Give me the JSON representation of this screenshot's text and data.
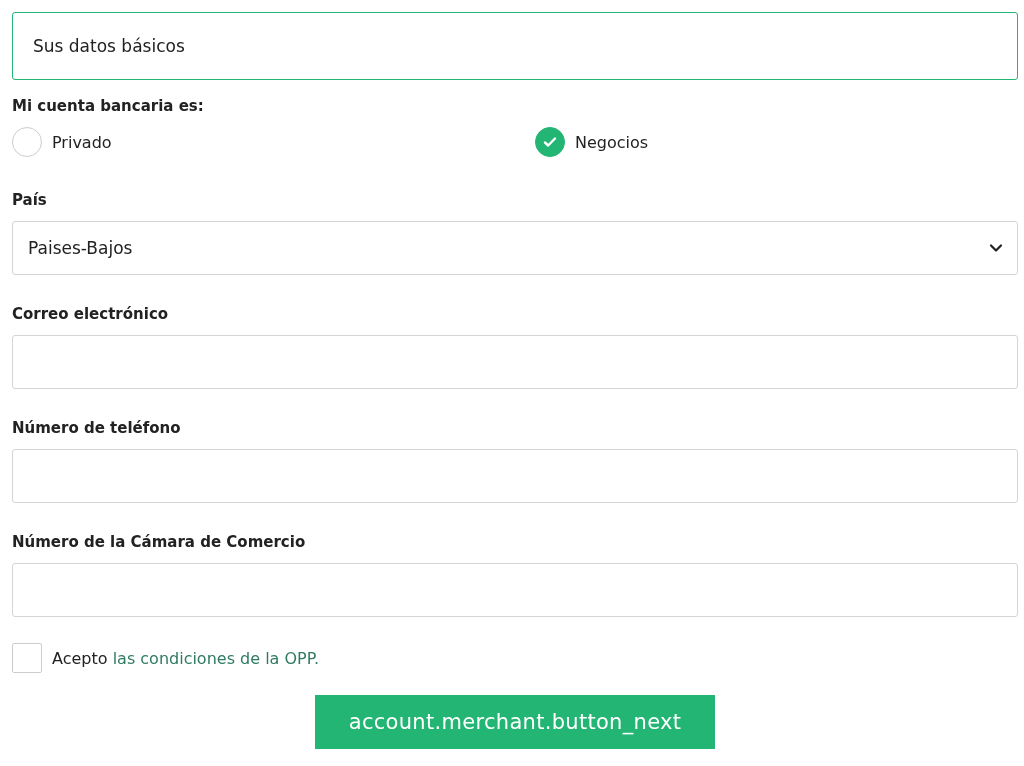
{
  "header": {
    "title": "Sus datos básicos"
  },
  "account_type": {
    "label": "Mi cuenta bancaria es:",
    "options": [
      {
        "label": "Privado",
        "selected": false
      },
      {
        "label": "Negocios",
        "selected": true
      }
    ]
  },
  "fields": [
    {
      "kind": "select",
      "label": "País",
      "value": "Paises-Bajos"
    },
    {
      "kind": "text",
      "label": "Correo electrónico"
    },
    {
      "kind": "text",
      "label": "Número de teléfono"
    },
    {
      "kind": "text",
      "label": "Número de la Cámara de Comercio"
    }
  ],
  "terms": {
    "checked": false,
    "text": "Acepto",
    "link": "las condiciones de la OPP."
  },
  "button": {
    "label": "account.merchant.button_next"
  }
}
